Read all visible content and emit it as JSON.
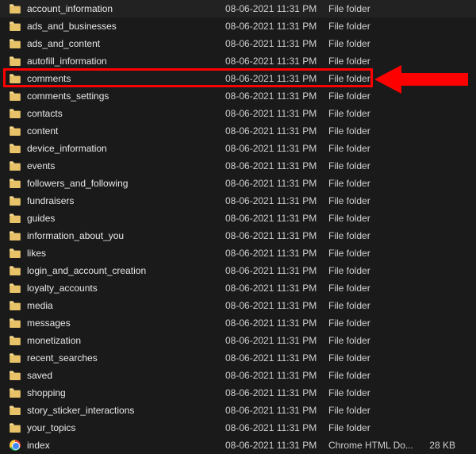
{
  "annotation": {
    "highlight_color": "#ff0000",
    "arrow_color": "#ff0000",
    "highlighted_index": 4
  },
  "files": [
    {
      "name": "account_information",
      "modified": "08-06-2021 11:31 PM",
      "type": "File folder",
      "size": "",
      "icon": "folder"
    },
    {
      "name": "ads_and_businesses",
      "modified": "08-06-2021 11:31 PM",
      "type": "File folder",
      "size": "",
      "icon": "folder"
    },
    {
      "name": "ads_and_content",
      "modified": "08-06-2021 11:31 PM",
      "type": "File folder",
      "size": "",
      "icon": "folder"
    },
    {
      "name": "autofill_information",
      "modified": "08-06-2021 11:31 PM",
      "type": "File folder",
      "size": "",
      "icon": "folder"
    },
    {
      "name": "comments",
      "modified": "08-06-2021 11:31 PM",
      "type": "File folder",
      "size": "",
      "icon": "folder"
    },
    {
      "name": "comments_settings",
      "modified": "08-06-2021 11:31 PM",
      "type": "File folder",
      "size": "",
      "icon": "folder"
    },
    {
      "name": "contacts",
      "modified": "08-06-2021 11:31 PM",
      "type": "File folder",
      "size": "",
      "icon": "folder"
    },
    {
      "name": "content",
      "modified": "08-06-2021 11:31 PM",
      "type": "File folder",
      "size": "",
      "icon": "folder"
    },
    {
      "name": "device_information",
      "modified": "08-06-2021 11:31 PM",
      "type": "File folder",
      "size": "",
      "icon": "folder"
    },
    {
      "name": "events",
      "modified": "08-06-2021 11:31 PM",
      "type": "File folder",
      "size": "",
      "icon": "folder"
    },
    {
      "name": "followers_and_following",
      "modified": "08-06-2021 11:31 PM",
      "type": "File folder",
      "size": "",
      "icon": "folder"
    },
    {
      "name": "fundraisers",
      "modified": "08-06-2021 11:31 PM",
      "type": "File folder",
      "size": "",
      "icon": "folder"
    },
    {
      "name": "guides",
      "modified": "08-06-2021 11:31 PM",
      "type": "File folder",
      "size": "",
      "icon": "folder"
    },
    {
      "name": "information_about_you",
      "modified": "08-06-2021 11:31 PM",
      "type": "File folder",
      "size": "",
      "icon": "folder"
    },
    {
      "name": "likes",
      "modified": "08-06-2021 11:31 PM",
      "type": "File folder",
      "size": "",
      "icon": "folder"
    },
    {
      "name": "login_and_account_creation",
      "modified": "08-06-2021 11:31 PM",
      "type": "File folder",
      "size": "",
      "icon": "folder"
    },
    {
      "name": "loyalty_accounts",
      "modified": "08-06-2021 11:31 PM",
      "type": "File folder",
      "size": "",
      "icon": "folder"
    },
    {
      "name": "media",
      "modified": "08-06-2021 11:31 PM",
      "type": "File folder",
      "size": "",
      "icon": "folder"
    },
    {
      "name": "messages",
      "modified": "08-06-2021 11:31 PM",
      "type": "File folder",
      "size": "",
      "icon": "folder"
    },
    {
      "name": "monetization",
      "modified": "08-06-2021 11:31 PM",
      "type": "File folder",
      "size": "",
      "icon": "folder"
    },
    {
      "name": "recent_searches",
      "modified": "08-06-2021 11:31 PM",
      "type": "File folder",
      "size": "",
      "icon": "folder"
    },
    {
      "name": "saved",
      "modified": "08-06-2021 11:31 PM",
      "type": "File folder",
      "size": "",
      "icon": "folder"
    },
    {
      "name": "shopping",
      "modified": "08-06-2021 11:31 PM",
      "type": "File folder",
      "size": "",
      "icon": "folder"
    },
    {
      "name": "story_sticker_interactions",
      "modified": "08-06-2021 11:31 PM",
      "type": "File folder",
      "size": "",
      "icon": "folder"
    },
    {
      "name": "your_topics",
      "modified": "08-06-2021 11:31 PM",
      "type": "File folder",
      "size": "",
      "icon": "folder"
    },
    {
      "name": "index",
      "modified": "08-06-2021 11:31 PM",
      "type": "Chrome HTML Do...",
      "size": "28 KB",
      "icon": "chrome"
    }
  ]
}
